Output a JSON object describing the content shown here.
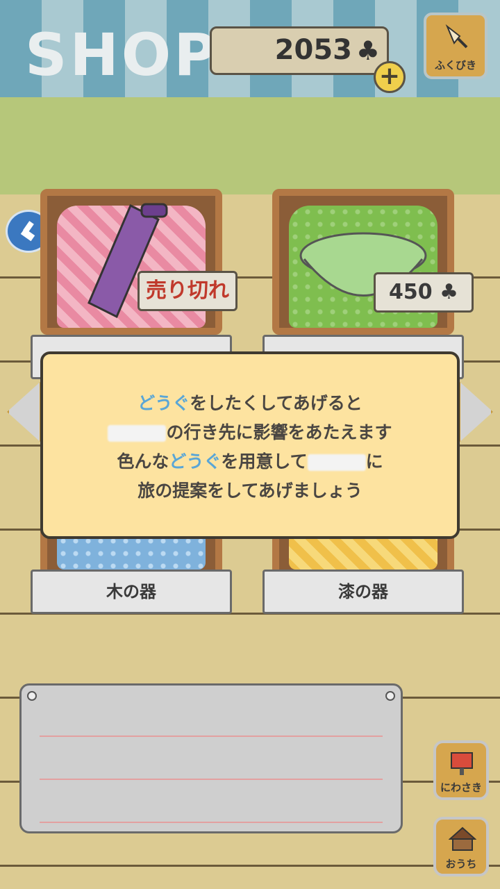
{
  "header": {
    "title": "SHOP",
    "coins": "2053",
    "coin_symbol": "♣",
    "add_symbol": "+",
    "gacha_label": "ふくびき"
  },
  "items": [
    {
      "price_or_status": "売り切れ",
      "status_color": "#c0392b",
      "cloth": "pink"
    },
    {
      "price_or_status": "450",
      "cloth": "green"
    },
    {
      "label": "木の器",
      "cloth": "blue"
    },
    {
      "label": "漆の器",
      "cloth": "yellow"
    }
  ],
  "dialog": {
    "line1_a": "どうぐ",
    "line1_b": "をしたくしてあげると",
    "line2": "の行き先に影響をあたえます",
    "line3_a": "色んな",
    "line3_b": "どうぐ",
    "line3_c": "を用意して",
    "line3_d": "に",
    "line4": "旅の提案をしてあげましょう"
  },
  "side_buttons": {
    "garden_label": "にわさき",
    "home_label": "おうち"
  },
  "colors": {
    "highlight": "#5aa6d6",
    "dialog_bg": "#fde3a0"
  }
}
